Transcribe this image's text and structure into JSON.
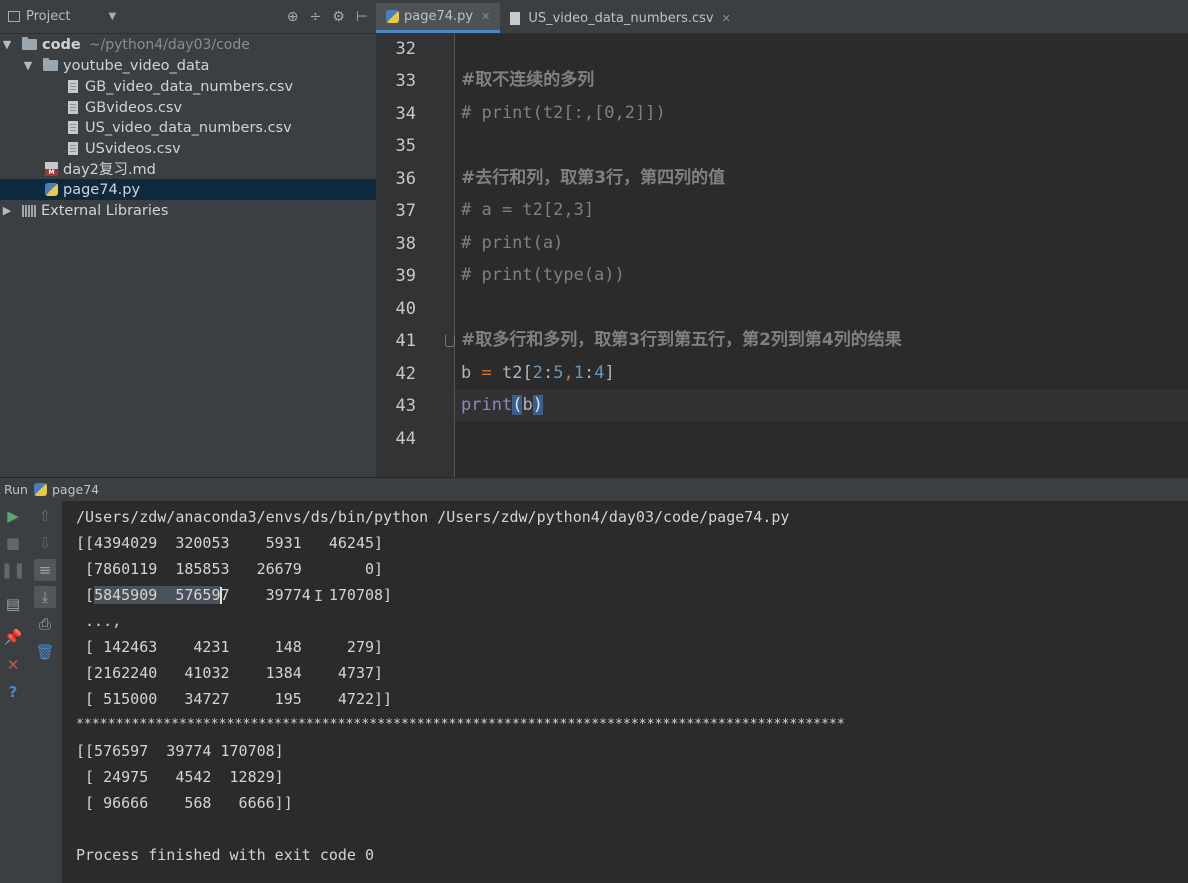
{
  "project_panel": {
    "header_label": "Project",
    "tree": [
      {
        "label": "code",
        "hint": "~/python4/day03/code"
      },
      {
        "label": "youtube_video_data"
      },
      {
        "label": "GB_video_data_numbers.csv"
      },
      {
        "label": "GBvideos.csv"
      },
      {
        "label": "US_video_data_numbers.csv"
      },
      {
        "label": "USvideos.csv"
      },
      {
        "label": "day2复习.md"
      },
      {
        "label": "page74.py"
      },
      {
        "label": "External Libraries"
      }
    ]
  },
  "editor": {
    "tabs": [
      {
        "label": "page74.py",
        "active": true
      },
      {
        "label": "US_video_data_numbers.csv",
        "active": false
      }
    ],
    "line_numbers": [
      "32",
      "33",
      "34",
      "35",
      "36",
      "37",
      "38",
      "39",
      "40",
      "41",
      "42",
      "43",
      "44"
    ],
    "lines": {
      "l33": "#取不连续的多列",
      "l34": "# print(t2[:,[0,2]])",
      "l36": "#去行和列，取第3行，第四列的值",
      "l37": "# a = t2[2,3]",
      "l38": "# print(a)",
      "l39": "# print(type(a))",
      "l41": "#取多行和多列，取第3行到第五行，第2列到第4列的结果",
      "l42": {
        "var": "b",
        "eq": "=",
        "obj": "t2",
        "open": "[",
        "n1": "2",
        "c1": ":",
        "n2": "5",
        "comma": ",",
        "n3": "1",
        "c2": ":",
        "n4": "4",
        "close": "]"
      },
      "l43": {
        "fn": "print",
        "open": "(",
        "arg": "b",
        "close": ")"
      }
    }
  },
  "run_panel": {
    "label": "Run",
    "config": "page74",
    "output": {
      "cmd": "/Users/zdw/anaconda3/envs/ds/bin/python /Users/zdw/python4/day03/code/page74.py",
      "o1": "[[4394029  320053    5931   46245]",
      "o2": " [7860119  185853   26679       0]",
      "o3a": " [",
      "o3b": "5845909  57659",
      "o3c": "7    39774  ",
      "o3d": "170708]",
      "o4": " ...,",
      "o5": " [ 142463    4231     148     279]",
      "o6": " [2162240   41032    1384    4737]",
      "o7": " [ 515000   34727     195    4722]]",
      "o8": "*************************************************************************************************",
      "o9": "[[576597  39774 170708]",
      "o10": " [ 24975   4542  12829]",
      "o11": " [ 96666    568   6666]]",
      "o12": "Process finished with exit code 0"
    }
  }
}
